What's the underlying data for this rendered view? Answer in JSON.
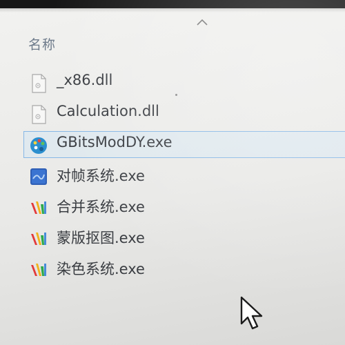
{
  "header": {
    "name_column": "名称"
  },
  "files": [
    {
      "name": "_x86.dll",
      "icon": "dll-file-icon",
      "selected": false
    },
    {
      "name": "Calculation.dll",
      "icon": "dll-file-icon",
      "selected": false
    },
    {
      "name": "GBitsModDY.exe",
      "icon": "palette-app-icon",
      "selected": true
    },
    {
      "name": "对帧系统.exe",
      "icon": "blue-app-icon",
      "selected": false
    },
    {
      "name": "合并系统.exe",
      "icon": "colorful-app-icon",
      "selected": false
    },
    {
      "name": "蒙版抠图.exe",
      "icon": "colorful-app-icon",
      "selected": false
    },
    {
      "name": "染色系统.exe",
      "icon": "colorful-app-icon",
      "selected": false
    }
  ],
  "colors": {
    "selection_border": "#86b7e6",
    "header_text": "#6d7a8a",
    "file_text": "#3a3d42"
  }
}
